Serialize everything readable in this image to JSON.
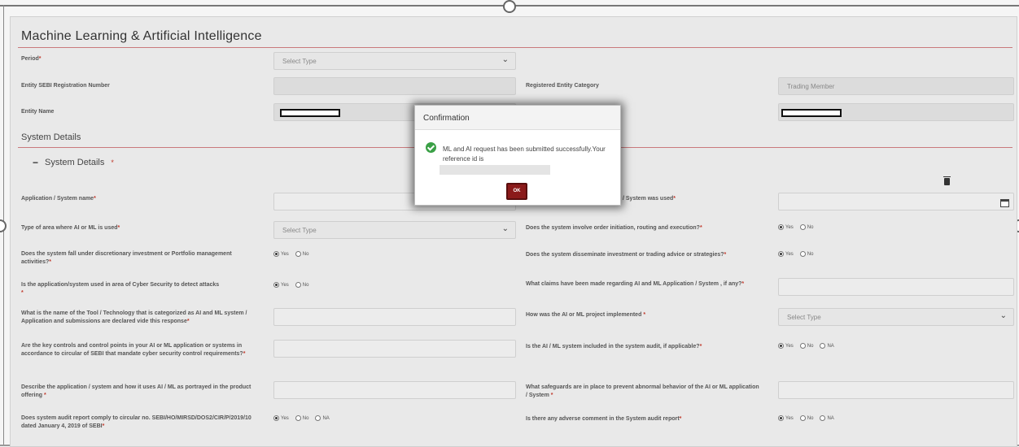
{
  "page": {
    "title": "Machine Learning & Artificial Intelligence",
    "section_system_details": "System Details",
    "subsection_system_details": "System Details",
    "required_mark": "*"
  },
  "fields": {
    "period_label": "Period",
    "period_value": "Select Type",
    "sebi_reg_label": "Entity SEBI Registration Number",
    "entity_category_label": "Registered Entity Category",
    "entity_category_value": "Trading Member",
    "entity_name_label": "Entity Name",
    "app_name_label": "Application / System name",
    "app_used_label_partial": "/ System was used",
    "area_type_label": "Type of area where AI or ML is used",
    "area_type_value": "Select Type",
    "order_init_label": "Does the system involve order initiation, routing and execution?",
    "discretionary_label": "Does the system fall under discretionary investment or Portfolio management activities?",
    "disseminate_label": "Does the system disseminate investment or trading advice or strategies?",
    "cyber_label": "Is the application/system used in area of Cyber Security to detect attacks",
    "claims_label": "What claims have been made regarding AI and ML Application / System , if any?",
    "tool_label": "What is the name of the Tool / Technology that is categorized as AI and ML system / Application and submissions are declared vide this response",
    "implemented_label": "How was the AI or ML project implemented",
    "implemented_value": "Select Type",
    "controls_label": "Are the key controls and control points in your AI or ML application or systems in accordance to circular of SEBI that mandate cyber security control requirements?",
    "audit_included_label": "Is the AI / ML system included in the system audit, if applicable?",
    "describe_label": "Describe the application / system and how it uses AI / ML as portrayed in the product offering",
    "safeguards_label": "What safeguards are in place to prevent abnormal behavior of the AI or ML application / System",
    "audit_comply_label": "Does system audit report comply to circular no. SEBI/HO/MIRSD/DOS2/CIR/P/2019/10 dated January 4, 2019 of SEBI",
    "adverse_label": "Is there any adverse comment in the System audit report"
  },
  "radio": {
    "yes": "Yes",
    "no": "No",
    "na": "NA"
  },
  "dialog": {
    "title": "Confirmation",
    "message": "ML and AI request has been submitted successfully.Your reference id is",
    "ok_label": "OK"
  },
  "icons": {
    "select": "chevron-down-icon",
    "delete": "trash-icon",
    "calendar": "calendar-icon",
    "success": "check-circle-icon",
    "collapse": "minus-icon"
  },
  "colors": {
    "accent": "#8b1a1a",
    "rule": "#c9797c",
    "success": "#3aa046"
  }
}
